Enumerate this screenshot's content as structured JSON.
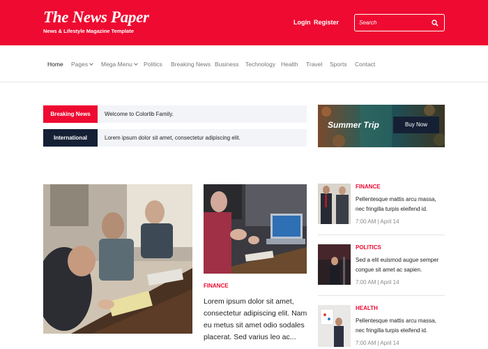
{
  "header": {
    "logo": "The News Paper",
    "tagline": "News & Lifestyle Magazine Template",
    "login": "Login",
    "register": "Register",
    "search_placeholder": "Search",
    "background_color": "#ee0a31"
  },
  "nav": {
    "items": [
      {
        "label": "Home"
      },
      {
        "label": "Pages"
      },
      {
        "label": "Mega Menu"
      },
      {
        "label": "Politics"
      },
      {
        "label": "Breaking News"
      },
      {
        "label": "Business"
      },
      {
        "label": "Technology"
      },
      {
        "label": "Health"
      },
      {
        "label": "Travel"
      },
      {
        "label": "Sports"
      },
      {
        "label": "Contact"
      }
    ]
  },
  "tickers": [
    {
      "label": "Breaking News",
      "text": "Welcome to Colorlib Family."
    },
    {
      "label": "International",
      "text": "Lorem ipsum dolor sit amet, consectetur adipiscing elit."
    }
  ],
  "ad": {
    "title": "Summer Trip",
    "button": "Buy Now"
  },
  "featured_mid": {
    "category": "FINANCE",
    "headline": "Lorem ipsum dolor sit amet, consectetur adipiscing elit. Nam eu metus sit amet odio sodales placerat. Sed varius leo ac..."
  },
  "side_posts": [
    {
      "category": "FINANCE",
      "title": "Pellentesque mattis arcu massa, nec fringilla turpis eleifend id.",
      "meta": "7:00 AM | April 14"
    },
    {
      "category": "POLITICS",
      "title": "Sed a elit euismod augue semper congue sit amet ac sapien.",
      "meta": "7:00 AM | April 14"
    },
    {
      "category": "HEALTH",
      "title": "Pellentesque mattis arcu massa, nec fringilla turpis eleifend id.",
      "meta": "7:00 AM | April 14"
    }
  ],
  "colors": {
    "accent": "#ee0a31",
    "navy": "#152035"
  }
}
